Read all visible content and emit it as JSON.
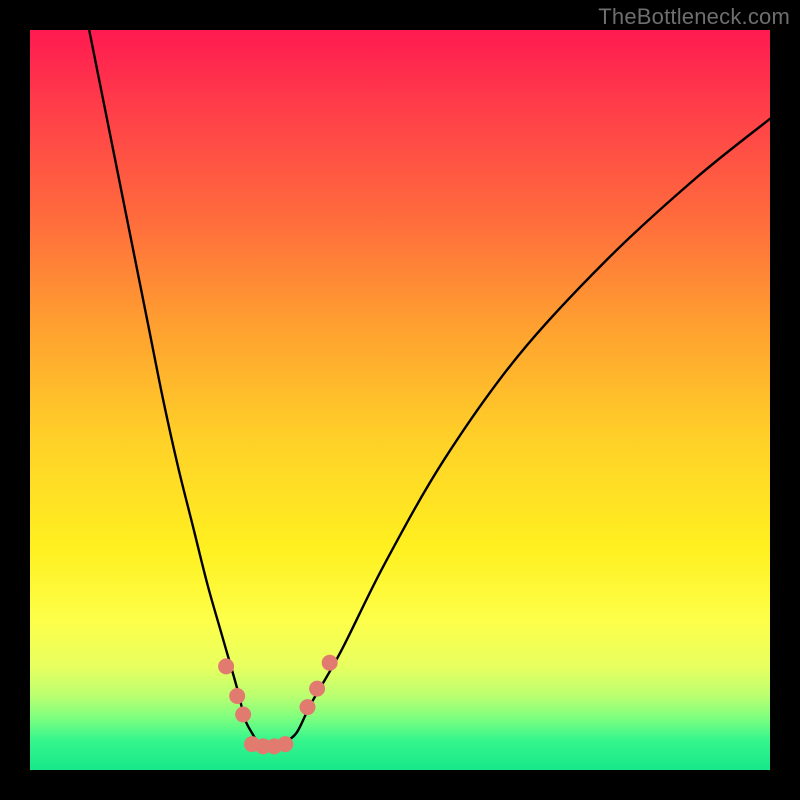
{
  "watermark": "TheBottleneck.com",
  "chart_data": {
    "type": "line",
    "title": "",
    "xlabel": "",
    "ylabel": "",
    "xlim": [
      0,
      100
    ],
    "ylim": [
      0,
      100
    ],
    "grid": false,
    "series": [
      {
        "name": "curve",
        "color": "#000000",
        "x": [
          8,
          10,
          12,
          14,
          16,
          18,
          20,
          22,
          24,
          26,
          28,
          29,
          30,
          31,
          32,
          33,
          34,
          36,
          38,
          42,
          48,
          56,
          66,
          78,
          90,
          100
        ],
        "y": [
          100,
          90,
          80,
          70,
          60,
          50,
          41,
          33,
          25,
          18,
          11,
          7,
          5,
          3.5,
          3,
          3,
          3.5,
          5,
          9,
          16,
          28,
          42,
          56,
          69,
          80,
          88
        ]
      }
    ],
    "markers": [
      {
        "x": 26.5,
        "y": 14,
        "r": 8,
        "color": "#e27b6f"
      },
      {
        "x": 28.0,
        "y": 10,
        "r": 8,
        "color": "#e27b6f"
      },
      {
        "x": 28.8,
        "y": 7.5,
        "r": 8,
        "color": "#e27b6f"
      },
      {
        "x": 30.0,
        "y": 3.5,
        "r": 8,
        "color": "#e27b6f"
      },
      {
        "x": 31.5,
        "y": 3.2,
        "r": 8,
        "color": "#e27b6f"
      },
      {
        "x": 33.0,
        "y": 3.2,
        "r": 8,
        "color": "#e27b6f"
      },
      {
        "x": 34.5,
        "y": 3.5,
        "r": 8,
        "color": "#e27b6f"
      },
      {
        "x": 37.5,
        "y": 8.5,
        "r": 8,
        "color": "#e27b6f"
      },
      {
        "x": 38.8,
        "y": 11,
        "r": 8,
        "color": "#e27b6f"
      },
      {
        "x": 40.5,
        "y": 14.5,
        "r": 8,
        "color": "#e27b6f"
      }
    ]
  }
}
